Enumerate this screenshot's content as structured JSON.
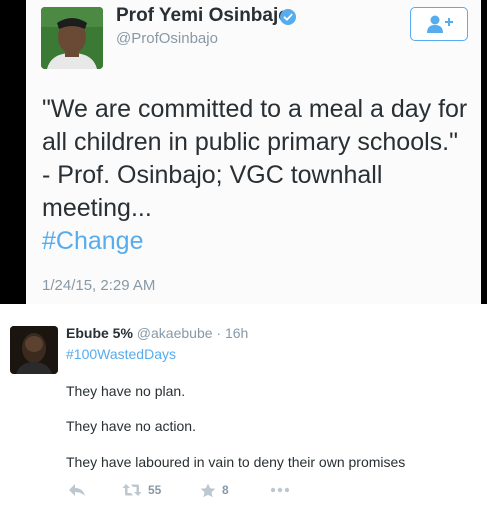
{
  "top_tweet": {
    "name": "Prof Yemi Osinbajo",
    "handle": "@ProfOsinbajo",
    "text_lines": [
      "\"We are committed to a meal a day for",
      "all children in public primary schools.\"",
      "- Prof. Osinbajo; VGC townhall",
      "meeting..."
    ],
    "hashtag": "#Change",
    "timestamp": "1/24/15, 2:29 AM"
  },
  "reply_tweet": {
    "name": "Ebube 5%",
    "handle": "@akaebube",
    "separator": "·",
    "time": "16h",
    "hashtag": "#100WastedDays",
    "lines": [
      "They have no plan.",
      "They have no action.",
      "They have laboured in vain to deny their own promises"
    ],
    "retweet_count": "55",
    "favorite_count": "8"
  },
  "colors": {
    "link": "#55acee",
    "muted": "#8899a6",
    "text": "#292f33"
  },
  "icons": [
    "verified-badge-icon",
    "follow-user-icon",
    "reply-icon",
    "retweet-icon",
    "favorite-star-icon",
    "more-icon"
  ]
}
